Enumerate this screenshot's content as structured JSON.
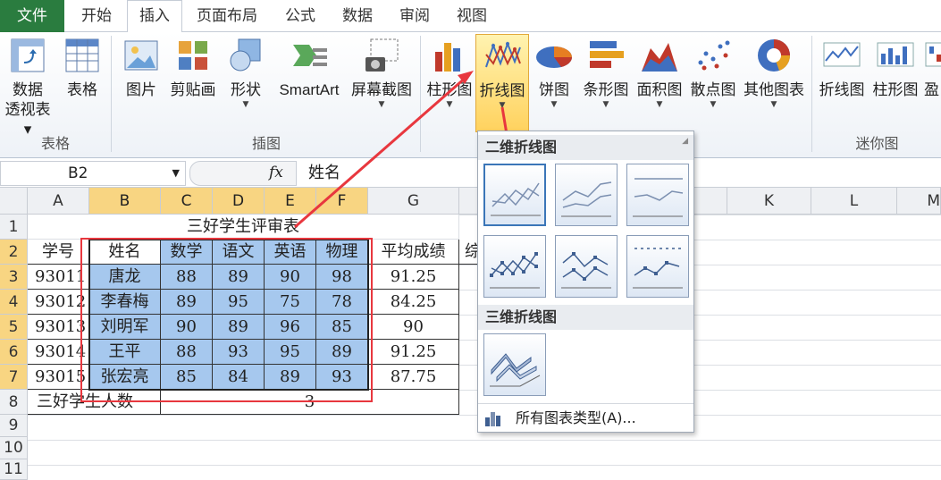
{
  "tabs": {
    "file": "文件",
    "items": [
      "开始",
      "插入",
      "页面布局",
      "公式",
      "数据",
      "审阅",
      "视图"
    ],
    "active": "插入"
  },
  "ribbon": {
    "pivot_label1": "数据",
    "pivot_label2": "透视表",
    "table_label": "表格",
    "picture_label": "图片",
    "clipart_label": "剪贴画",
    "shapes_label": "形状",
    "smartart_label": "SmartArt",
    "screenshot_label": "屏幕截图",
    "column_chart_label": "柱形图",
    "line_chart_label": "折线图",
    "pie_chart_label": "饼图",
    "bar_chart_label": "条形图",
    "area_chart_label": "面积图",
    "scatter_chart_label": "散点图",
    "other_charts_label": "其他图表",
    "spark_line_label": "折线图",
    "spark_column_label": "柱形图",
    "spark_winloss_label": "盈",
    "group_tables": "表格",
    "group_illustrations": "插图",
    "group_sparklines": "迷你图"
  },
  "formula_bar": {
    "name_box": "B2",
    "fx": "fx",
    "value": "姓名"
  },
  "sheet": {
    "columns": [
      "A",
      "B",
      "C",
      "D",
      "E",
      "F",
      "G",
      "K",
      "L",
      "M"
    ],
    "rows": [
      "1",
      "2",
      "3",
      "4",
      "5",
      "6",
      "7",
      "8",
      "9",
      "10",
      "11"
    ],
    "title": "三好学生评审表",
    "headers": [
      "学号",
      "姓名",
      "数学",
      "语文",
      "英语",
      "物理",
      "平均成绩",
      "综"
    ],
    "data": [
      [
        "93011",
        "唐龙",
        "88",
        "89",
        "90",
        "98",
        "91.25"
      ],
      [
        "93012",
        "李春梅",
        "89",
        "95",
        "75",
        "78",
        "84.25"
      ],
      [
        "93013",
        "刘明军",
        "90",
        "89",
        "96",
        "85",
        "90"
      ],
      [
        "93014",
        "王平",
        "88",
        "93",
        "95",
        "89",
        "91.25"
      ],
      [
        "93015",
        "张宏亮",
        "85",
        "84",
        "89",
        "93",
        "87.75"
      ]
    ],
    "count_label": "三好学生人数",
    "count_value": "3"
  },
  "dropdown": {
    "section_2d": "二维折线图",
    "section_3d": "三维折线图",
    "all_types": "所有图表类型(A)..."
  },
  "colors": {
    "file_tab": "#2a7c3f",
    "selection_fill": "#a6c8ee",
    "selected_header": "#f8d582",
    "annotation_red": "#e8373e"
  }
}
